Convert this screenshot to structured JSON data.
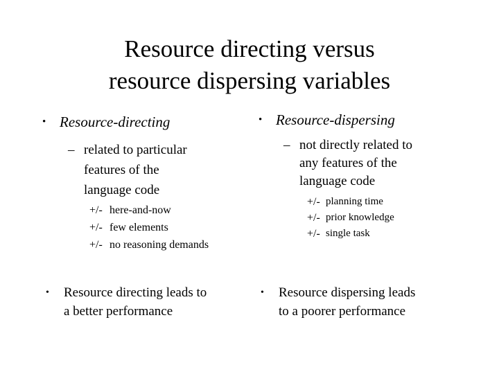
{
  "slide": {
    "title": {
      "line1": "Resource directing versus",
      "line2": "resource dispersing variables"
    },
    "bullet_marker": "•",
    "dash_marker": "–",
    "plusminus_marker": "+/-",
    "left_column": {
      "heading": "Resource-directing",
      "sub_lines": [
        "related to particular",
        "features of the",
        "language code"
      ],
      "items": [
        "here-and-now",
        "few elements",
        "no reasoning demands"
      ],
      "conclusion_lines": [
        "Resource directing leads to",
        "a better performance"
      ]
    },
    "right_column": {
      "heading": "Resource-dispersing",
      "sub_lines": [
        "not directly related to",
        "any features of the",
        "language code"
      ],
      "items": [
        "planning time",
        "prior knowledge",
        "single task"
      ],
      "conclusion_lines": [
        "Resource dispersing leads",
        "to a poorer performance"
      ]
    }
  }
}
